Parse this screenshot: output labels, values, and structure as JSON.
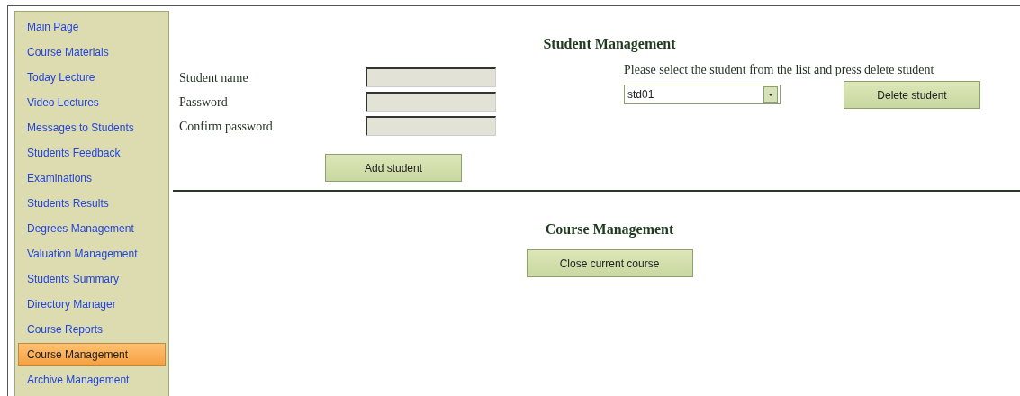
{
  "sidebar": {
    "items": [
      {
        "label": "Main Page",
        "selected": false
      },
      {
        "label": "Course Materials",
        "selected": false
      },
      {
        "label": "Today Lecture",
        "selected": false
      },
      {
        "label": "Video Lectures",
        "selected": false
      },
      {
        "label": "Messages to Students",
        "selected": false
      },
      {
        "label": "Students Feedback",
        "selected": false
      },
      {
        "label": "Examinations",
        "selected": false
      },
      {
        "label": "Students Results",
        "selected": false
      },
      {
        "label": "Degrees Management",
        "selected": false
      },
      {
        "label": "Valuation Management",
        "selected": false
      },
      {
        "label": "Students Summary",
        "selected": false
      },
      {
        "label": "Directory Manager",
        "selected": false
      },
      {
        "label": "Course Reports",
        "selected": false
      },
      {
        "label": "Course Management",
        "selected": true
      },
      {
        "label": "Archive Management",
        "selected": false
      }
    ]
  },
  "student_management": {
    "title": "Student Management",
    "fields": [
      {
        "label": "Student name"
      },
      {
        "label": "Password"
      },
      {
        "label": "Confirm password"
      }
    ],
    "add_button": "Add student",
    "delete_instruction": "Please select the student from the list and press delete student",
    "student_select": {
      "value": "std01"
    },
    "delete_button": "Delete student"
  },
  "course_management": {
    "title": "Course Management",
    "close_button": "Close current course"
  }
}
